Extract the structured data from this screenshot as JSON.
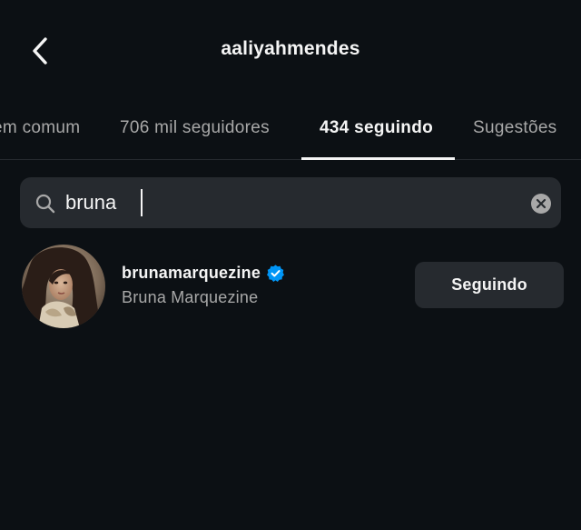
{
  "header": {
    "title": "aaliyahmendes",
    "back_icon": "chevron-left-icon"
  },
  "tabs": [
    {
      "label": "em comum",
      "active": false
    },
    {
      "label": "706 mil seguidores",
      "active": false
    },
    {
      "label": "434 seguindo",
      "active": true
    },
    {
      "label": "Sugestões",
      "active": false
    }
  ],
  "search": {
    "value": "bruna",
    "icon": "search-icon",
    "clear_icon": "clear-icon"
  },
  "results": [
    {
      "username": "brunamarquezine",
      "full_name": "Bruna Marquezine",
      "verified": true,
      "button_label": "Seguindo"
    }
  ],
  "colors": {
    "background": "#0c1014",
    "surface": "#262a2f",
    "text_primary": "#f5f5f5",
    "text_secondary": "#a8a8a8",
    "verified": "#0095f6"
  }
}
